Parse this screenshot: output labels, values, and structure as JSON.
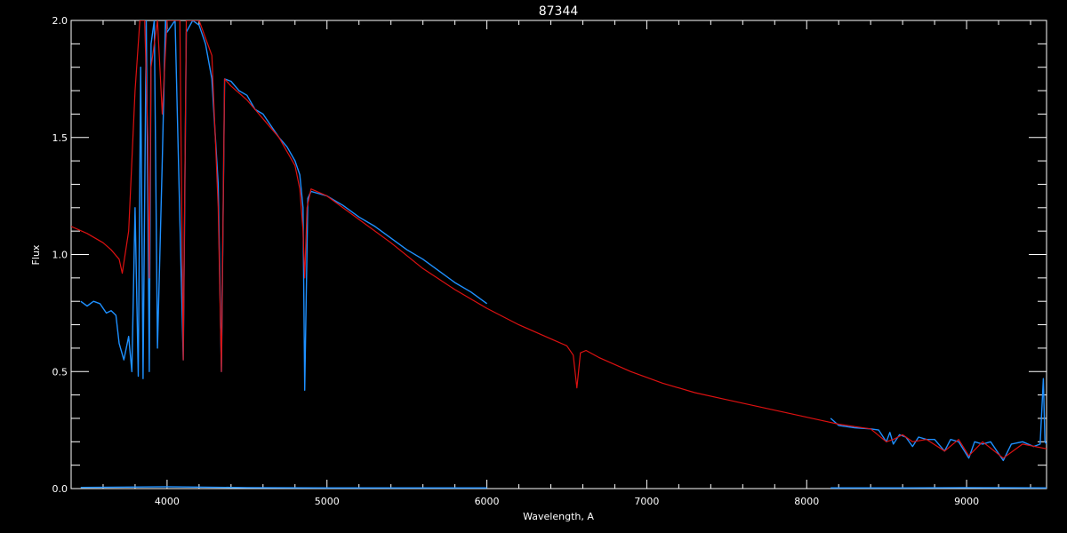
{
  "chart_data": {
    "type": "line",
    "title": "87344",
    "xlabel": "Wavelength, A",
    "ylabel": "Flux",
    "xlim": [
      3400,
      9500
    ],
    "ylim": [
      0,
      2.0
    ],
    "x_ticks": [
      4000,
      5000,
      6000,
      7000,
      8000,
      9000
    ],
    "x_tick_labels": [
      "4000",
      "5000",
      "6000",
      "7000",
      "8000",
      "9000"
    ],
    "y_ticks": [
      0,
      0.5,
      1.0,
      1.5,
      2.0
    ],
    "y_tick_labels": [
      "0.0",
      "0.5",
      "1.0",
      "1.5",
      "2.0"
    ],
    "colors": {
      "background": "#000000",
      "axes": "#ffffff",
      "model": "#dd1111",
      "observed": "#1e90ff",
      "observed_alt": "#ffffff"
    },
    "series": [
      {
        "id": "model",
        "color": "#dd1111",
        "x": [
          3400,
          3500,
          3600,
          3650,
          3700,
          3720,
          3760,
          3800,
          3830,
          3860,
          3880,
          3889,
          3900,
          3940,
          3970,
          4000,
          4080,
          4101,
          4120,
          4200,
          4280,
          4320,
          4340,
          4360,
          4400,
          4500,
          4600,
          4700,
          4800,
          4830,
          4850,
          4861,
          4875,
          4900,
          5000,
          5200,
          5400,
          5600,
          5800,
          6000,
          6200,
          6400,
          6500,
          6540,
          6563,
          6585,
          6620,
          6700,
          6900,
          7100,
          7300,
          7500,
          7700,
          7900,
          8100,
          8200,
          8300,
          8400,
          8498,
          8542,
          8600,
          8662,
          8750,
          8862,
          8950,
          9014,
          9100,
          9229,
          9350,
          9500
        ],
        "y": [
          1.12,
          1.09,
          1.05,
          1.02,
          0.98,
          0.92,
          1.1,
          1.7,
          2.0,
          2.0,
          1.5,
          0.9,
          1.8,
          2.0,
          1.6,
          2.0,
          2.0,
          0.55,
          2.0,
          2.0,
          1.85,
          1.2,
          0.5,
          1.75,
          1.72,
          1.66,
          1.58,
          1.5,
          1.38,
          1.28,
          1.1,
          0.9,
          1.2,
          1.28,
          1.25,
          1.15,
          1.05,
          0.94,
          0.85,
          0.77,
          0.7,
          0.64,
          0.61,
          0.57,
          0.43,
          0.58,
          0.59,
          0.56,
          0.5,
          0.45,
          0.41,
          0.38,
          0.35,
          0.32,
          0.29,
          0.275,
          0.265,
          0.255,
          0.2,
          0.21,
          0.23,
          0.2,
          0.21,
          0.16,
          0.21,
          0.14,
          0.2,
          0.13,
          0.19,
          0.17
        ]
      },
      {
        "id": "observed-blue",
        "color": "#1e90ff",
        "x": [
          3460,
          3500,
          3540,
          3580,
          3620,
          3650,
          3680,
          3700,
          3730,
          3760,
          3780,
          3800,
          3820,
          3835,
          3850,
          3870,
          3889,
          3900,
          3920,
          3940,
          3970,
          3990,
          4000,
          4050,
          4101,
          4120,
          4160,
          4200,
          4240,
          4280,
          4320,
          4340,
          4360,
          4400,
          4450,
          4500,
          4550,
          4600,
          4650,
          4700,
          4750,
          4800,
          4830,
          4850,
          4861,
          4880,
          4900,
          4950,
          5000,
          5100,
          5200,
          5300,
          5400,
          5500,
          5600,
          5700,
          5800,
          5900,
          6000
        ],
        "y": [
          0.8,
          0.78,
          0.8,
          0.79,
          0.75,
          0.76,
          0.74,
          0.62,
          0.55,
          0.65,
          0.5,
          1.2,
          0.48,
          1.8,
          0.47,
          2.0,
          0.5,
          1.9,
          2.0,
          0.6,
          1.4,
          2.0,
          1.95,
          2.0,
          0.55,
          1.95,
          2.0,
          1.98,
          1.9,
          1.75,
          1.3,
          0.5,
          1.75,
          1.74,
          1.7,
          1.68,
          1.62,
          1.6,
          1.55,
          1.5,
          1.46,
          1.4,
          1.34,
          1.2,
          0.42,
          1.24,
          1.27,
          1.26,
          1.25,
          1.21,
          1.16,
          1.12,
          1.07,
          1.02,
          0.98,
          0.93,
          0.88,
          0.84,
          0.79
        ]
      },
      {
        "id": "observed-red-arm",
        "color": "#1e90ff",
        "x": [
          8150,
          8200,
          8300,
          8400,
          8450,
          8498,
          8520,
          8542,
          8580,
          8620,
          8662,
          8700,
          8750,
          8800,
          8862,
          8900,
          8950,
          9014,
          9050,
          9100,
          9150,
          9229,
          9280,
          9350,
          9420,
          9460,
          9480,
          9490,
          9500
        ],
        "y": [
          0.3,
          0.27,
          0.26,
          0.255,
          0.25,
          0.2,
          0.24,
          0.19,
          0.23,
          0.22,
          0.18,
          0.22,
          0.21,
          0.21,
          0.16,
          0.21,
          0.2,
          0.13,
          0.2,
          0.19,
          0.2,
          0.12,
          0.19,
          0.2,
          0.18,
          0.19,
          0.47,
          0.2,
          0.19
        ]
      },
      {
        "id": "error-baseline",
        "color": "#1e90ff",
        "x": [
          3460,
          4000,
          4500,
          5000,
          5500,
          6000
        ],
        "y": [
          0.005,
          0.008,
          0.004,
          0.003,
          0.003,
          0.003
        ]
      },
      {
        "id": "error-baseline-red",
        "color": "#1e90ff",
        "x": [
          8150,
          8600,
          9000,
          9500
        ],
        "y": [
          0.003,
          0.003,
          0.004,
          0.003
        ]
      }
    ]
  }
}
